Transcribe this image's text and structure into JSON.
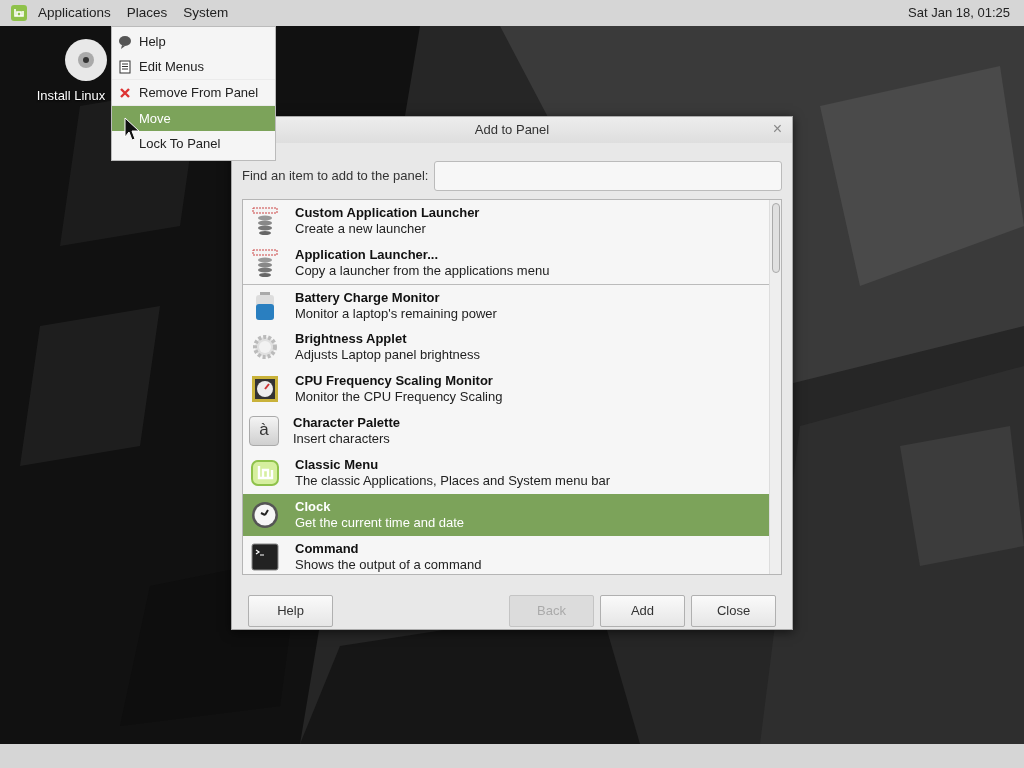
{
  "top_panel": {
    "menus": [
      {
        "label": "Applications"
      },
      {
        "label": "Places"
      },
      {
        "label": "System"
      }
    ],
    "clock": "Sat Jan 18, 01:25"
  },
  "desktop_icons": [
    {
      "label": "Install Linux"
    }
  ],
  "context_menu": {
    "groups": [
      [
        {
          "label": "Help",
          "selected": false
        },
        {
          "label": "Edit Menus",
          "selected": false
        }
      ],
      [
        {
          "label": "Remove From Panel",
          "selected": false
        }
      ],
      [
        {
          "label": "Move",
          "selected": true
        },
        {
          "label": "Lock To Panel",
          "selected": false
        }
      ]
    ]
  },
  "dialog": {
    "title": "Add to Panel",
    "close": "×",
    "search": {
      "label": "Find an item to add to the panel:"
    },
    "groups": [
      [
        {
          "name": "Custom Application Launcher",
          "description": "Create a new launcher",
          "selected": false
        },
        {
          "name": "Application Launcher...",
          "description": "Copy a launcher from the applications menu",
          "selected": false
        }
      ],
      [
        {
          "name": "Battery Charge Monitor",
          "description": "Monitor a laptop's remaining power",
          "selected": false
        },
        {
          "name": "Brightness Applet",
          "description": "Adjusts Laptop panel brightness",
          "selected": false
        },
        {
          "name": "CPU Frequency Scaling Monitor",
          "description": "Monitor the CPU Frequency Scaling",
          "selected": false
        },
        {
          "name": "Character Palette",
          "description": "Insert characters",
          "selected": false,
          "glyph": "à"
        },
        {
          "name": "Classic Menu",
          "description": "The classic Applications, Places and System menu bar",
          "selected": false
        },
        {
          "name": "Clock",
          "description": "Get the current time and date",
          "selected": true
        },
        {
          "name": "Command",
          "description": "Shows the output of a command",
          "selected": false
        }
      ]
    ],
    "buttons": [
      {
        "label": "Help",
        "disabled": false
      },
      {
        "label": "Back",
        "disabled": true
      },
      {
        "label": "Add",
        "disabled": false
      },
      {
        "label": "Close",
        "disabled": false
      }
    ]
  }
}
